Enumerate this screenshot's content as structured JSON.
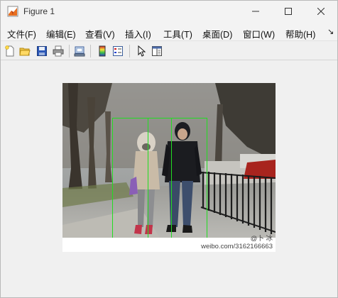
{
  "window": {
    "title": "Figure 1",
    "controls": {
      "minimize_icon": "minimize-icon",
      "maximize_icon": "maximize-icon",
      "close_icon": "close-icon"
    }
  },
  "menu": {
    "items": [
      {
        "label": "文件(F)"
      },
      {
        "label": "编辑(E)"
      },
      {
        "label": "查看(V)"
      },
      {
        "label": "插入(I)"
      },
      {
        "label": "工具(T)"
      },
      {
        "label": "桌面(D)"
      },
      {
        "label": "窗口(W)"
      },
      {
        "label": "帮助(H)"
      }
    ],
    "overflow_icon": "chevron-overflow-icon"
  },
  "toolbar": {
    "items": [
      {
        "icon": "new-figure-icon"
      },
      {
        "icon": "open-file-icon"
      },
      {
        "icon": "save-icon"
      },
      {
        "icon": "print-icon"
      },
      {
        "icon": "link-plot-icon"
      },
      {
        "icon": "colorbar-icon"
      },
      {
        "icon": "legend-icon"
      },
      {
        "icon": "pointer-icon"
      },
      {
        "icon": "property-editor-icon"
      }
    ]
  },
  "image": {
    "watermark_line1": "@卜 冰",
    "watermark_line2": "weibo.com/3162166663",
    "detection_box_color": "#22dd22"
  }
}
